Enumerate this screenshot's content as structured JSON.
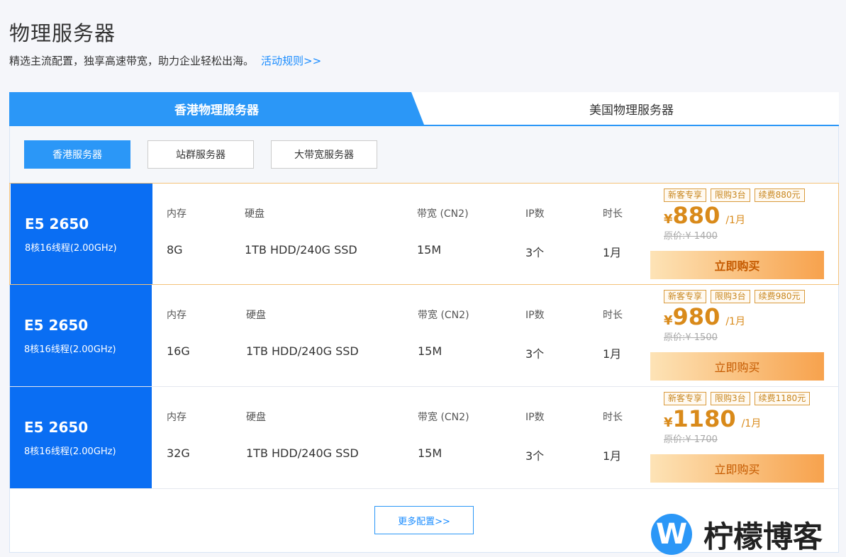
{
  "header": {
    "title": "物理服务器",
    "subtitle": "精选主流配置，独享高速带宽，助力企业轻松出海。",
    "rule_link": "活动规则>>"
  },
  "main_tabs": [
    {
      "label": "香港物理服务器",
      "active": true
    },
    {
      "label": "美国物理服务器",
      "active": false
    }
  ],
  "sub_tabs": [
    {
      "label": "香港服务器",
      "active": true
    },
    {
      "label": "站群服务器",
      "active": false
    },
    {
      "label": "大带宽服务器",
      "active": false
    }
  ],
  "spec_headers": {
    "memory": "内存",
    "disk": "硬盘",
    "bandwidth": "带宽 (CN2)",
    "ip": "IP数",
    "duration": "时长"
  },
  "plans": [
    {
      "cpu": "E5 2650",
      "cpu_desc": "8核16线程(2.00GHz)",
      "memory": "8G",
      "disk": "1TB HDD/240G SSD",
      "bandwidth": "15M",
      "ip": "3个",
      "duration": "1月",
      "tags": [
        "新客专享",
        "限购3台",
        "续费880元"
      ],
      "currency": "¥",
      "price": "880",
      "price_unit": "/1月",
      "original_price": "原价:¥ 1400",
      "buy_label": "立即购买"
    },
    {
      "cpu": "E5 2650",
      "cpu_desc": "8核16线程(2.00GHz)",
      "memory": "16G",
      "disk": "1TB HDD/240G SSD",
      "bandwidth": "15M",
      "ip": "3个",
      "duration": "1月",
      "tags": [
        "新客专享",
        "限购3台",
        "续费980元"
      ],
      "currency": "¥",
      "price": "980",
      "price_unit": "/1月",
      "original_price": "原价:¥ 1500",
      "buy_label": "立即购买"
    },
    {
      "cpu": "E5 2650",
      "cpu_desc": "8核16线程(2.00GHz)",
      "memory": "32G",
      "disk": "1TB HDD/240G SSD",
      "bandwidth": "15M",
      "ip": "3个",
      "duration": "1月",
      "tags": [
        "新客专享",
        "限购3台",
        "续费1180元"
      ],
      "currency": "¥",
      "price": "1180",
      "price_unit": "/1月",
      "original_price": "原价:¥ 1700",
      "buy_label": "立即购买"
    }
  ],
  "more_button": "更多配置>>",
  "watermark": {
    "logo_letter": "W",
    "text": "柠檬博客"
  },
  "colors": {
    "primary": "#2b97f7",
    "cpu_block": "#0a6ef3",
    "price": "#d98a1a"
  }
}
